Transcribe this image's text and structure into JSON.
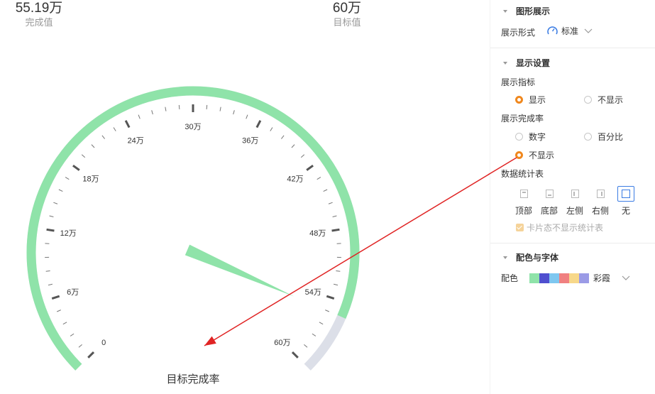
{
  "stats": {
    "complete_value": "55.19万",
    "complete_label": "完成值",
    "target_value": "60万",
    "target_label": "目标值"
  },
  "gauge": {
    "title": "目标完成率",
    "min": 0,
    "max": 60,
    "value": 55.19,
    "tick_labels": [
      "0",
      "6万",
      "12万",
      "18万",
      "24万",
      "30万",
      "36万",
      "42万",
      "48万",
      "54万",
      "60万"
    ],
    "colors": {
      "progress": "#8fe3a9",
      "track": "#dcdfe8",
      "pointer": "#8fe3a9",
      "tick": "#666666",
      "minor_tick": "#777777"
    }
  },
  "sidebar": {
    "section_chart": {
      "title": "图形展示",
      "display_form_label": "展示形式",
      "display_form_value": "标准"
    },
    "section_display": {
      "title": "显示设置",
      "indicator_label": "展示指标",
      "indicator_options": [
        "显示",
        "不显示"
      ],
      "indicator_selected": 0,
      "rate_label": "展示完成率",
      "rate_options": [
        "数字",
        "百分比",
        "不显示"
      ],
      "rate_selected": 2,
      "table_label": "数据统计表",
      "table_positions": [
        "顶部",
        "底部",
        "左侧",
        "右侧",
        "无"
      ],
      "table_selected": 4,
      "card_checkbox_label": "卡片态不显示统计表"
    },
    "section_color": {
      "title": "配色与字体",
      "palette_label": "配色",
      "palette_name": "彩霞",
      "palette_colors": [
        "#8fe3a9",
        "#4f4fcf",
        "#7ec7f0",
        "#f08080",
        "#f7d88a",
        "#9b9be6"
      ]
    }
  },
  "annotation": {
    "color": "#e02424"
  }
}
